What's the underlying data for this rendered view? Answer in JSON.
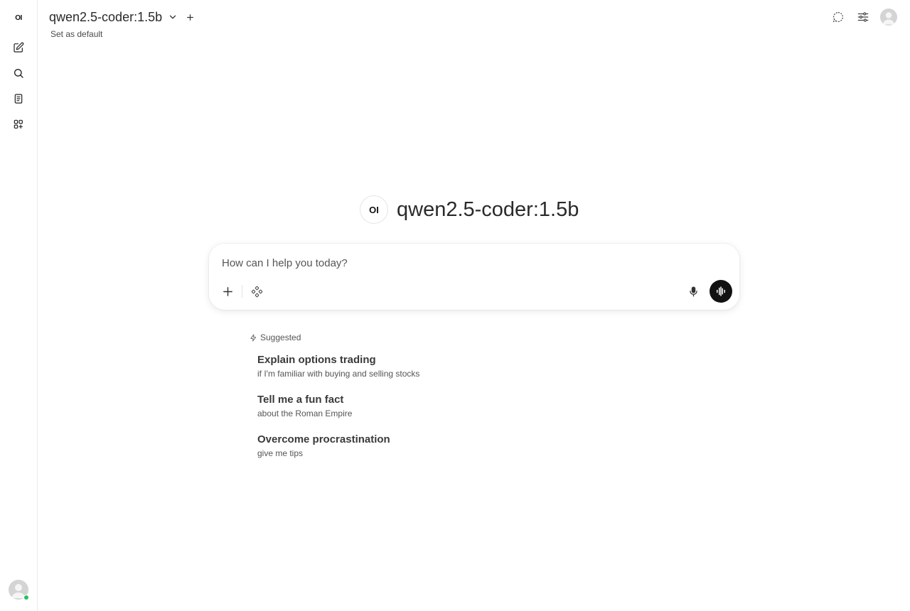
{
  "sidebar": {
    "logo_text": "OI",
    "items": [
      {
        "name": "new-chat",
        "icon": "pencil-square-icon"
      },
      {
        "name": "search",
        "icon": "search-icon"
      },
      {
        "name": "notes",
        "icon": "notes-icon"
      },
      {
        "name": "workspace",
        "icon": "apps-plus-icon"
      }
    ],
    "status_color": "#22c55e"
  },
  "header": {
    "model_name": "qwen2.5-coder:1.5b",
    "set_default_label": "Set as default",
    "right_icons": [
      "temporary-chat-icon",
      "controls-sliders-icon",
      "user-avatar"
    ]
  },
  "hero": {
    "logo_text": "OI",
    "model_title": "qwen2.5-coder:1.5b"
  },
  "composer": {
    "placeholder": "How can I help you today?",
    "value": "",
    "voice_button_color": "#111111"
  },
  "suggested": {
    "heading": "Suggested",
    "items": [
      {
        "title": "Explain options trading",
        "subtitle": "if I'm familiar with buying and selling stocks"
      },
      {
        "title": "Tell me a fun fact",
        "subtitle": "about the Roman Empire"
      },
      {
        "title": "Overcome procrastination",
        "subtitle": "give me tips"
      }
    ]
  }
}
